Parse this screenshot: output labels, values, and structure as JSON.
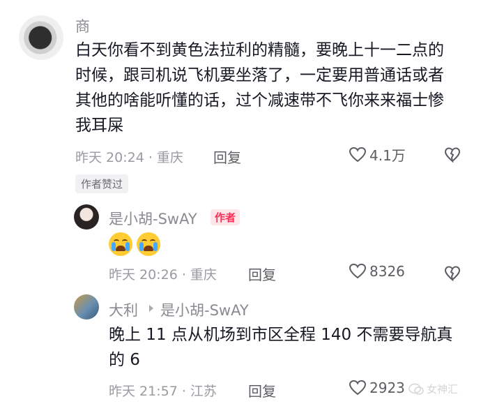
{
  "comments": [
    {
      "username": "商",
      "text": "白天你看不到黄色法拉利的精髓，要晚上十一二点的时候，跟司机说飞机要坐落了，一定要用普通话或者其他的啥能听懂的话，过个减速带不飞你来来福士惨我耳屎",
      "time_location": "昨天 20:24 · 重庆",
      "reply_label": "回复",
      "likes": "4.1万",
      "tag": "作者赞过",
      "icons": {
        "like": "heart-outline-icon",
        "dislike": "broken-heart-icon"
      }
    },
    {
      "username": "是小胡-SwAY",
      "badge": "作者",
      "text": "😭😭",
      "time_location": "昨天 20:26 · 重庆",
      "reply_label": "回复",
      "likes": "8326"
    },
    {
      "username": "大利",
      "reply_to": "是小胡-SwAY",
      "text": "晚上 11 点从机场到市区全程 140 不需要导航真的 6",
      "time_location": "昨天 21:57 · 江苏",
      "reply_label": "回复",
      "likes": "2923"
    }
  ],
  "watermark": "女神汇"
}
